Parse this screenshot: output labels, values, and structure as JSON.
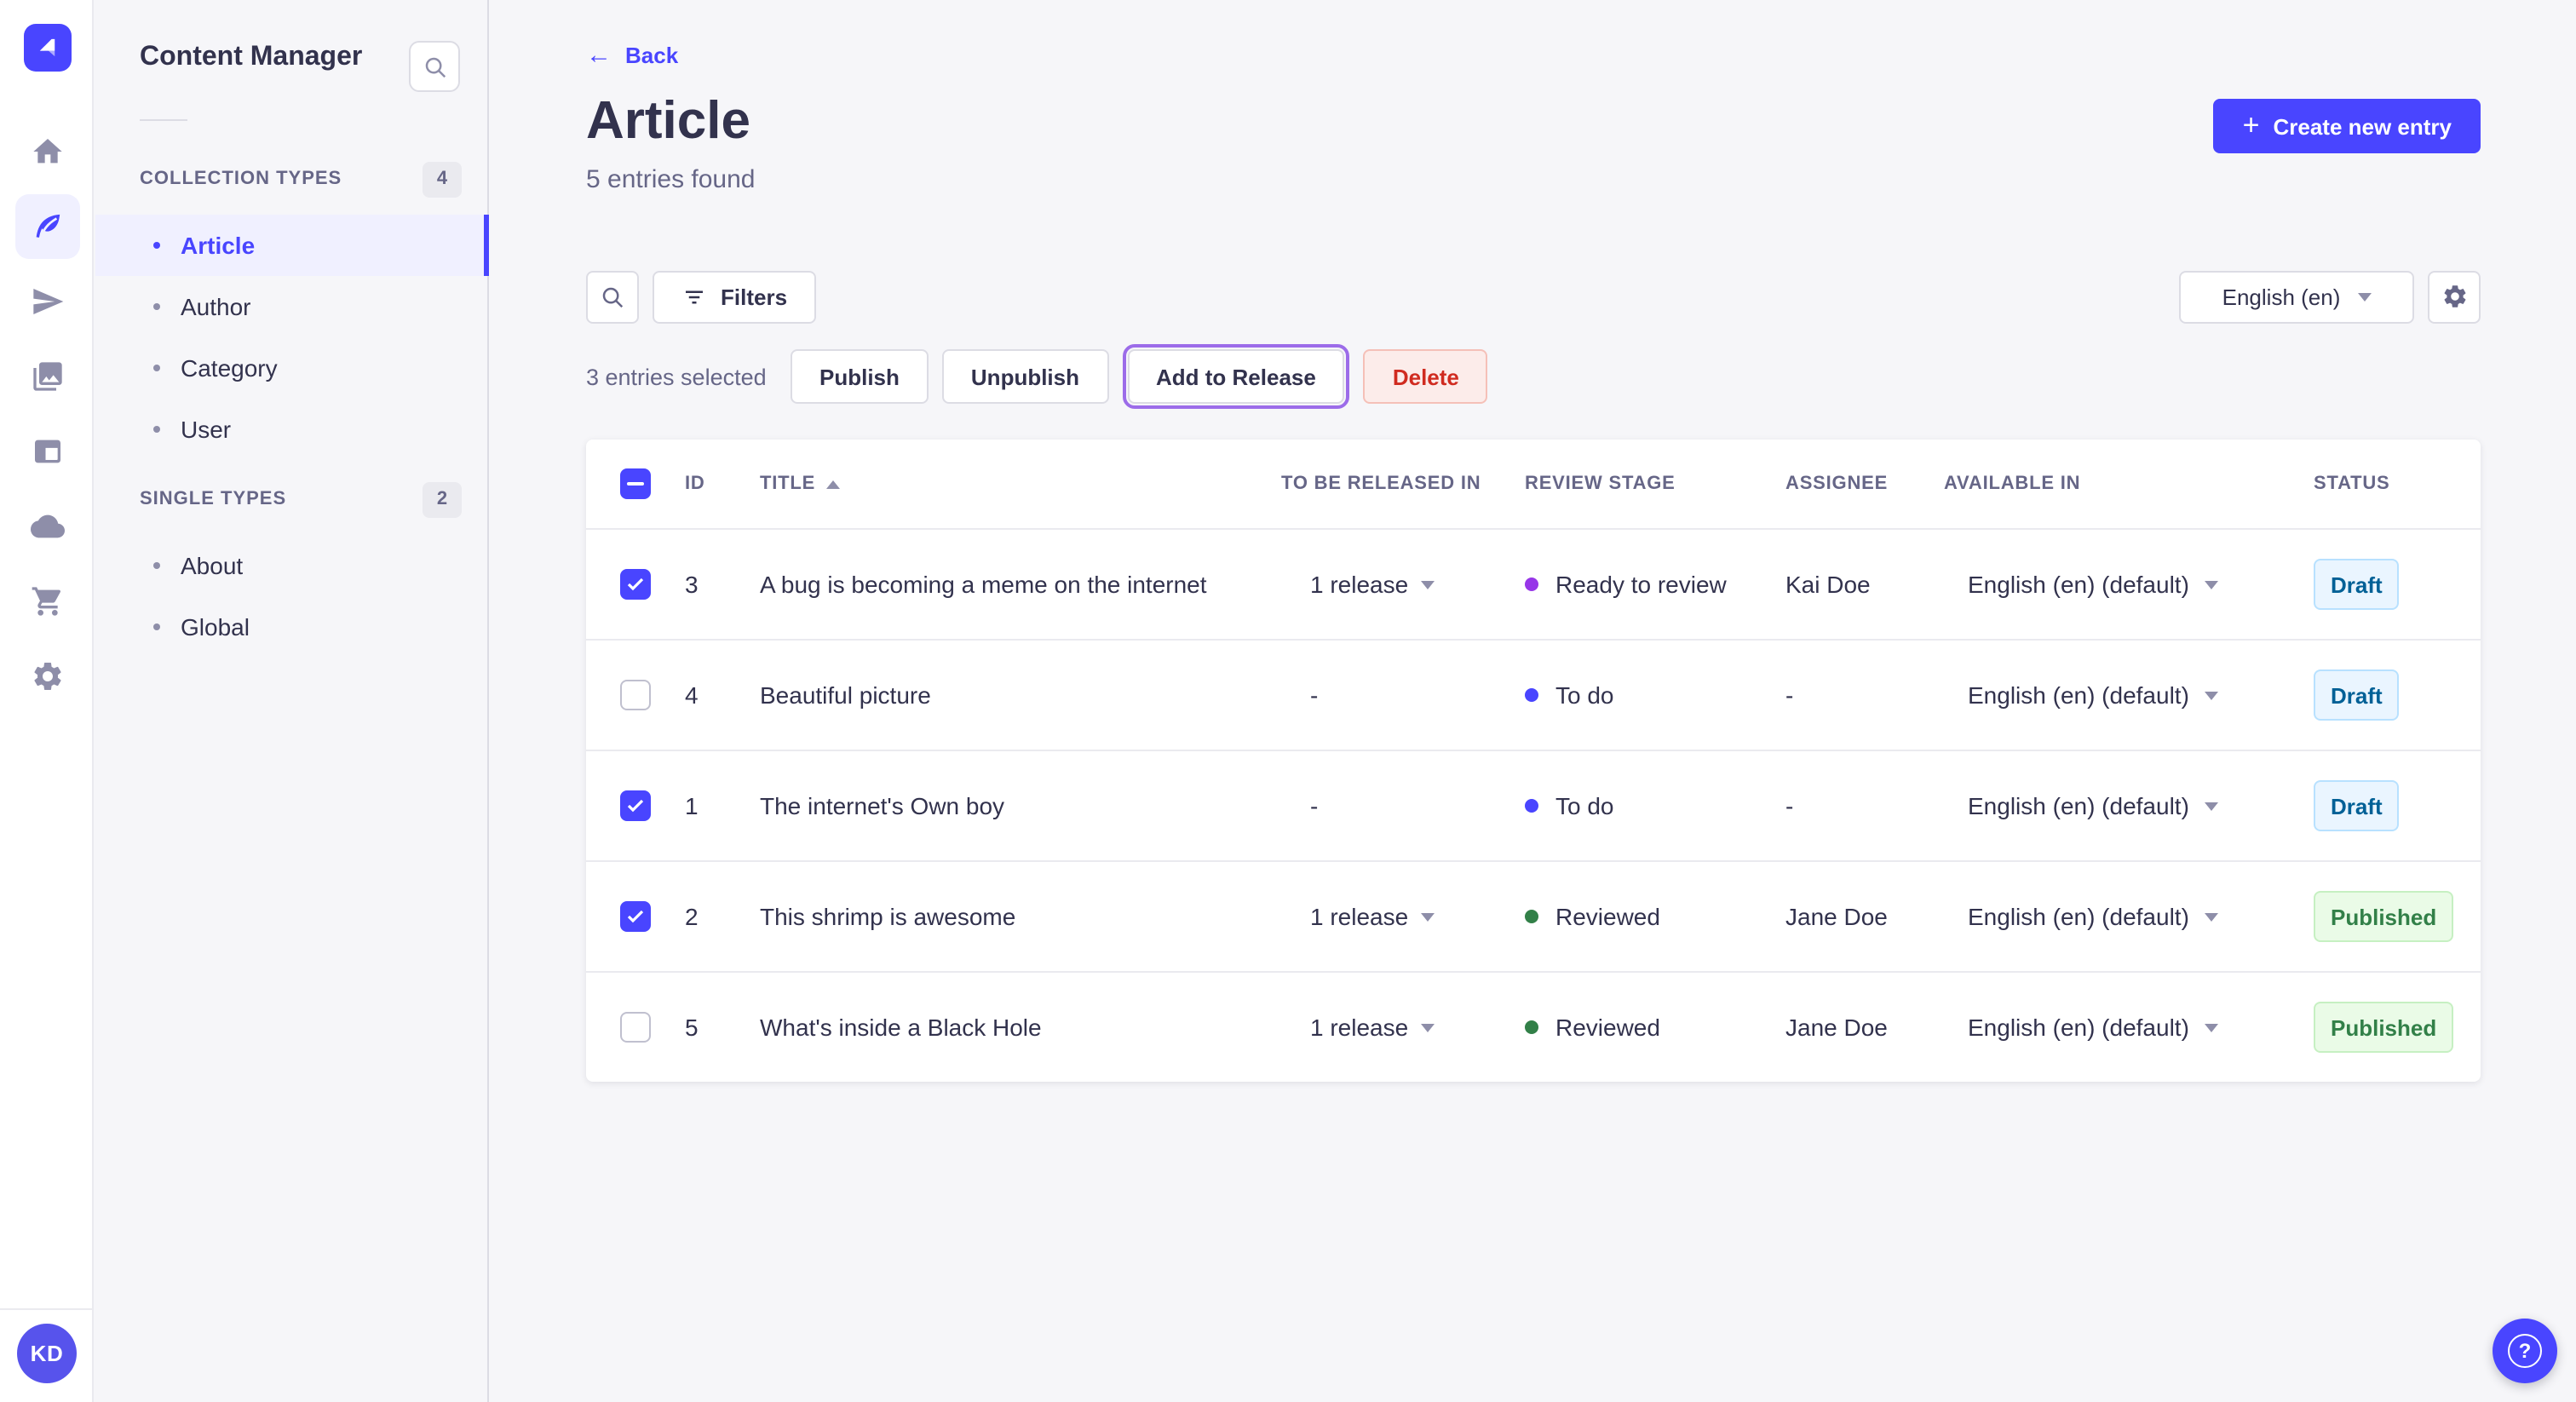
{
  "nav": {
    "icons": [
      "strapi-logo",
      "home",
      "content-manager-feather",
      "send-plane",
      "media-library-pictures",
      "content-type-builder-layout",
      "cloud",
      "marketplace-cart",
      "settings-gear"
    ],
    "active_icon": "content-manager-feather",
    "avatar_initials": "KD"
  },
  "subnav": {
    "title": "Content Manager",
    "sections": [
      {
        "label": "COLLECTION TYPES",
        "badge": "4",
        "items": [
          {
            "label": "Article",
            "active": true
          },
          {
            "label": "Author"
          },
          {
            "label": "Category"
          },
          {
            "label": "User"
          }
        ]
      },
      {
        "label": "SINGLE TYPES",
        "badge": "2",
        "items": [
          {
            "label": "About"
          },
          {
            "label": "Global"
          }
        ]
      }
    ]
  },
  "header": {
    "back_label": "Back",
    "title": "Article",
    "subtitle": "5 entries found",
    "create_button": "Create new entry"
  },
  "toolbar": {
    "filters_label": "Filters",
    "locale_selected": "English (en)"
  },
  "bulk": {
    "selected_text": "3 entries selected",
    "publish": "Publish",
    "unpublish": "Unpublish",
    "add_to_release": "Add to Release",
    "delete": "Delete"
  },
  "table": {
    "columns": [
      "ID",
      "TITLE",
      "TO BE RELEASED IN",
      "REVIEW STAGE",
      "ASSIGNEE",
      "AVAILABLE IN",
      "STATUS"
    ],
    "sorted_column": "TITLE",
    "sort_direction": "ascending",
    "rows": [
      {
        "checked": true,
        "id": "3",
        "title": "A bug is becoming a meme on the internet",
        "to_be_released_in": "1 release",
        "review_stage": "Ready to review",
        "review_stage_color": "#9736e8",
        "assignee": "Kai Doe",
        "available_in": "English (en) (default)",
        "status": "Draft"
      },
      {
        "checked": false,
        "id": "4",
        "title": "Beautiful picture",
        "to_be_released_in": "-",
        "review_stage": "To do",
        "review_stage_color": "#4945ff",
        "assignee": "-",
        "available_in": "English (en) (default)",
        "status": "Draft"
      },
      {
        "checked": true,
        "id": "1",
        "title": "The internet's Own boy",
        "to_be_released_in": "-",
        "review_stage": "To do",
        "review_stage_color": "#4945ff",
        "assignee": "-",
        "available_in": "English (en) (default)",
        "status": "Draft"
      },
      {
        "checked": true,
        "id": "2",
        "title": "This shrimp is awesome",
        "to_be_released_in": "1 release",
        "review_stage": "Reviewed",
        "review_stage_color": "#328048",
        "assignee": "Jane Doe",
        "available_in": "English (en) (default)",
        "status": "Published"
      },
      {
        "checked": false,
        "id": "5",
        "title": "What's inside a Black Hole",
        "to_be_released_in": "1 release",
        "review_stage": "Reviewed",
        "review_stage_color": "#328048",
        "assignee": "Jane Doe",
        "available_in": "English (en) (default)",
        "status": "Published"
      }
    ]
  },
  "colors": {
    "primary": "#4945ff",
    "release_focus_ring": "#9c6ce9",
    "draft_text": "#006096",
    "published_text": "#328048",
    "delete_text": "#d02b20",
    "ready_to_review_dot": "#9736e8",
    "to_do_dot": "#4945ff",
    "reviewed_dot": "#328048"
  }
}
